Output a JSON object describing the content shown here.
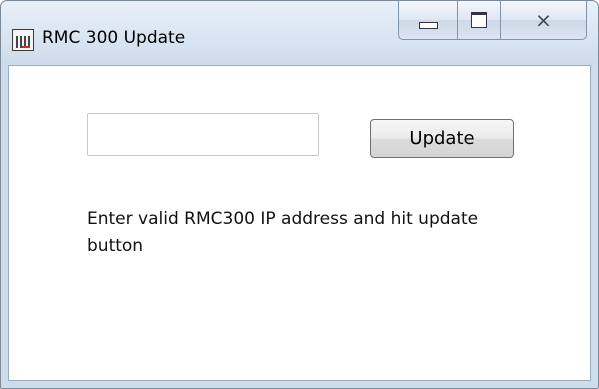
{
  "window": {
    "title": "RMC 300 Update",
    "icon": "rmc-app-icon",
    "controls": {
      "minimize_icon": "minimize-icon",
      "maximize_icon": "maximize-icon",
      "close_icon": "close-icon",
      "close_glyph": "⨯"
    }
  },
  "form": {
    "ip_input": {
      "value": "",
      "placeholder": ""
    },
    "update_button_label": "Update",
    "hint_text": "Enter valid RMC300 IP address and hit update button"
  },
  "colors": {
    "titlebar": "#d8e4f1",
    "client_background": "#ffffff",
    "button_face": "#e5e5e5"
  }
}
